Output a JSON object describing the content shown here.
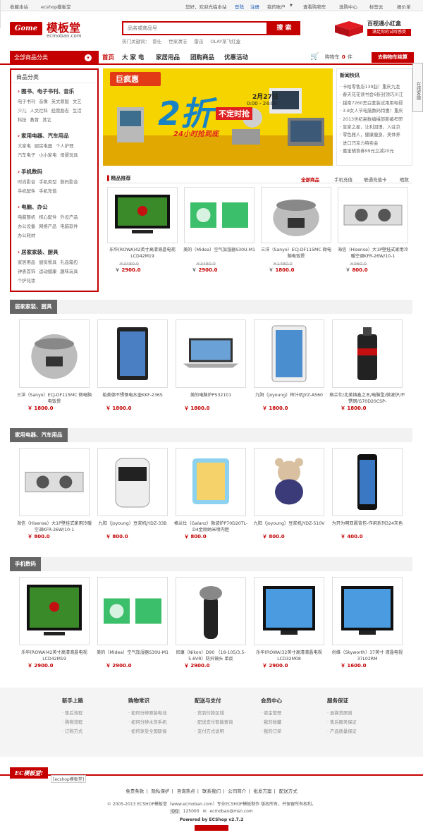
{
  "topbar": {
    "favorite": "收藏本站",
    "shop": "ecshop模板堂",
    "welcome": "您好，欢迎光临本站",
    "login": "登陆",
    "register": "注册",
    "account": "我的账户",
    "view_cart": "查看购物车",
    "center": "选购中心",
    "tags": "标签云",
    "price": "报价单"
  },
  "logo": {
    "badge": "Gome",
    "cn": "模板堂",
    "en": "ecmoban.com"
  },
  "search": {
    "placeholder": "品名或商品号",
    "button": "搜 索",
    "hot_label": "热门关键词：",
    "hot": [
      "冒仕",
      "世家清洁",
      "雷迅",
      "OLAY某飞红盒"
    ]
  },
  "promo": {
    "title": "百视通小红盒",
    "subtitle": "满足你的试听感受"
  },
  "nav": {
    "all_cat": "全部商品分类",
    "items": [
      "首页",
      "大 家 电",
      "家居用品",
      "团购商品",
      "优惠活动"
    ],
    "cart_label": "购物车",
    "cart_count": "0",
    "cart_unit": "件",
    "checkout": "去购物车结算"
  },
  "sidecat": {
    "title": "商品分类",
    "groups": [
      {
        "name": "图书、电子书刊、音乐",
        "links": [
          "电子书刊",
          "音像",
          "英文原版",
          "文艺",
          "少儿",
          "人文社科",
          "经管励志",
          "生活",
          "科技",
          "教育",
          "其它"
        ]
      },
      {
        "name": "家用电器、汽车用品",
        "links": [
          "大家电",
          "厨房电器",
          "个人护理",
          "汽车电子",
          "小小家电",
          "母婴玩具"
        ]
      },
      {
        "name": "手机数码",
        "links": [
          "时尚影音",
          "手机类型",
          "数码影音",
          "手机配件",
          "手机充值"
        ]
      },
      {
        "name": "电脑、办公",
        "links": [
          "电脑整机",
          "核心配件",
          "外设产品",
          "办公设备",
          "网络产品",
          "电脑软件",
          "办公耗材"
        ]
      },
      {
        "name": "居家家装、厨具",
        "links": [
          "家居用品",
          "厨房餐具",
          "礼品箱包",
          "钟表首饰",
          "运动健康",
          "趣味玩具",
          "个护化妆"
        ]
      }
    ]
  },
  "banner": {
    "brand": "巨疯惠",
    "big": "2折",
    "tag": "不定时抢",
    "date": "2月27日",
    "time": "0:00 - 24:00",
    "sub": "24小时抢到底"
  },
  "news": {
    "title": "新闻快讯",
    "items": [
      "· 卡帕零售店139起！重庆九龙",
      "· 春天花花读书会6折封顶巧川江",
      "· 越南7260黑白套装试用用电视",
      "· 3.8女人节电脑数码特惠！重庆",
      "· 2013世纪高数编缉部新编考研",
      "· 皇家之星，让利回馈，入驻京",
      "· 零色雅人，健康瘦身，美体养",
      "· 进口巧克力特卖会",
      "· 嘉宝辅食券99元立减20元"
    ]
  },
  "rec": {
    "title": "精品推荐",
    "tabs": [
      "全部商品",
      "手机充值",
      "联通充值卡",
      "晒数"
    ],
    "items": [
      {
        "name": "乐华(ROWA)42英寸高清液晶电视LCD42M19",
        "old": "￥3480.0",
        "label": "￥",
        "price": "2900.0"
      },
      {
        "name": "美的（Midea）空气加湿器S30U-M1",
        "old": "￥3480.0",
        "label": "￥",
        "price": "2900.0"
      },
      {
        "name": "三洋（Sanyo）ECJ-DF115MC 微电脑电饭煲",
        "old": "￥1480.0",
        "label": "￥",
        "price": "1800.0"
      },
      {
        "name": "海信（Hisense）大1P壁挂式家用冷暖空调KFR-26W/10-1",
        "old": "￥960.0",
        "label": "￥",
        "price": "800.0"
      }
    ]
  },
  "sections": [
    {
      "title": "居家家装、厨具",
      "items": [
        {
          "name": "三洋（Sanyo）ECJ-DF115MC 微电脑电饭煲",
          "price": "￥ 1800.0"
        },
        {
          "name": "裕美德不锈钢电水壶KKF-236S",
          "price": "￥ 1800.0"
        },
        {
          "name": "美的电脑炉PS32101",
          "price": "￥ 1800.0"
        },
        {
          "name": "九阳（joyoung）榨汁机JYZ-A560",
          "price": "￥ 1800.0"
        },
        {
          "name": "格兰仕/北美铸鑫之王/电脑型/微波炉/不锈钢/G70D20CSP-",
          "price": "￥ 1800.0"
        }
      ]
    },
    {
      "title": "家用电器、汽车用品",
      "items": [
        {
          "name": "海信（Hisense）大1P壁挂式家用冷暖空调KFR-26W/10-1",
          "price": "￥ 800.0"
        },
        {
          "name": "九阳（joyoung）豆浆机JYDZ-33B",
          "price": "￥ 800.0"
        },
        {
          "name": "格兰仕（Galanz）微波炉P70D20TL-D4金刚纳米喷内胆",
          "price": "￥ 800.0"
        },
        {
          "name": "九阳（joyoung）豆浆机JYDZ-510V",
          "price": "￥ 800.0"
        },
        {
          "name": "为开为明双晨背包-作闲系列324灰色",
          "price": "￥ 400.0"
        }
      ]
    },
    {
      "title": "手机数码",
      "items": [
        {
          "name": "乐华(ROWA)42英寸高清液晶电视LCD42M19",
          "price": "￥ 2900.0"
        },
        {
          "name": "美的（Midea）空气加湿器S30U-M1",
          "price": "￥ 2900.0"
        },
        {
          "name": "尼康（Nikon）D90 （18-105/3.5-5.6VR）防抖镜头 单反",
          "price": "￥ 2900.0"
        },
        {
          "name": "乐华(ROWA)32英寸高清液晶电视LCD32M08",
          "price": "￥ 2900.0"
        },
        {
          "name": "创维（Skyworth）37英寸 液晶电视 37L02RM",
          "price": "￥ 1600.0"
        }
      ]
    }
  ],
  "footer": {
    "cols": [
      {
        "title": "新手上路",
        "links": [
          "售后流程",
          "购物流程",
          "订购方式"
        ]
      },
      {
        "title": "购物常识",
        "links": [
          "如何分辨原装电池",
          "如何分辨水货手机",
          "如何享受全国联保"
        ]
      },
      {
        "title": "配送与支付",
        "links": [
          "货到付款区域",
          "配送支付智能查询",
          "支付方式说明"
        ]
      },
      {
        "title": "会员中心",
        "links": [
          "资金管理",
          "我的收藏",
          "我的订单"
        ]
      },
      {
        "title": "服务保证",
        "links": [
          "退换货原则",
          "售后服务保证",
          "产品质量保证"
        ]
      }
    ],
    "logo": "EC模板堂!",
    "tag": "[ecshop模板堂]",
    "links": [
      "免责条款",
      "隐私保护",
      "咨询热点",
      "联系我们",
      "公司简介",
      "批发方案",
      "配送方式"
    ],
    "copy": "© 2005-2013 ECSHOP模板堂（www.ecmoban.com）专业ECSHOP模板制作 版权所有，并保留所有权利。",
    "qq": "125000",
    "email": "ecmoban@msn.com",
    "powered": "Powered by ECShop v2.7.2"
  },
  "float": "在线客服"
}
